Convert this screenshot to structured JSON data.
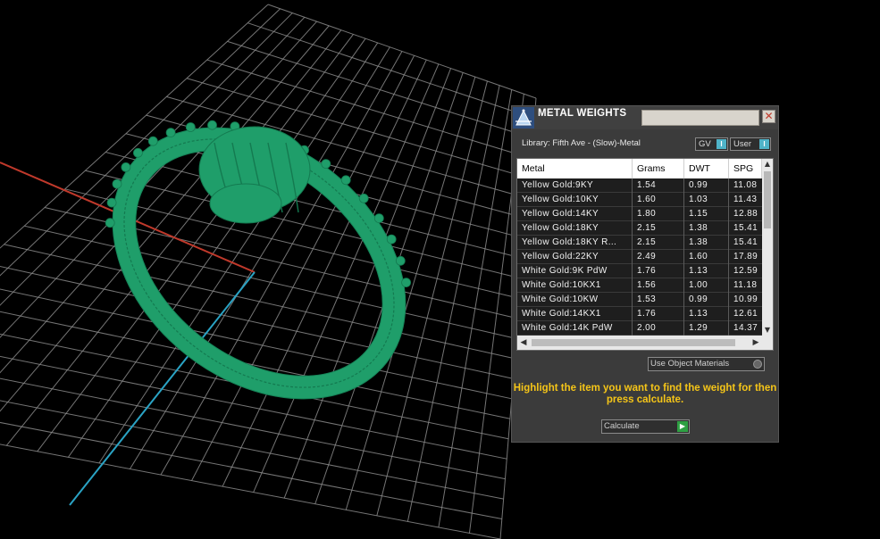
{
  "panel": {
    "title": "METAL WEIGHTS",
    "close_symbol": "✕",
    "library_label": "Library: Fifth Ave - (Slow)-Metal",
    "toggles": [
      {
        "label": "GV",
        "indicator": "I"
      },
      {
        "label": "User",
        "indicator": "I"
      }
    ],
    "table": {
      "columns": [
        "Metal",
        "Grams",
        "DWT",
        "SPG"
      ],
      "rows": [
        [
          "Yellow Gold:9KY",
          "1.54",
          "0.99",
          "11.08"
        ],
        [
          "Yellow Gold:10KY",
          "1.60",
          "1.03",
          "11.43"
        ],
        [
          "Yellow Gold:14KY",
          "1.80",
          "1.15",
          "12.88"
        ],
        [
          "Yellow Gold:18KY",
          "2.15",
          "1.38",
          "15.41"
        ],
        [
          "Yellow Gold:18KY R...",
          "2.15",
          "1.38",
          "15.41"
        ],
        [
          "Yellow Gold:22KY",
          "2.49",
          "1.60",
          "17.89"
        ],
        [
          "White Gold:9K PdW",
          "1.76",
          "1.13",
          "12.59"
        ],
        [
          "White Gold:10KX1",
          "1.56",
          "1.00",
          "11.18"
        ],
        [
          "White Gold:10KW",
          "1.53",
          "0.99",
          "10.99"
        ],
        [
          "White Gold:14KX1",
          "1.76",
          "1.13",
          "12.61"
        ],
        [
          "White Gold:14K PdW",
          "2.00",
          "1.29",
          "14.37"
        ]
      ]
    },
    "use_object_materials": "Use Object Materials",
    "instructions": "Highlight the item you want to find the weight for then press calculate.",
    "calculate_label": "Calculate"
  },
  "viewport": {
    "model_color": "#1f9e6a",
    "grid_color": "#8a8a8a",
    "axis_x_color": "#c0392b",
    "axis_y_color": "#2aa3c4"
  },
  "icons": {
    "title": "scale-icon",
    "close": "close-icon",
    "calculate": "play-icon"
  }
}
